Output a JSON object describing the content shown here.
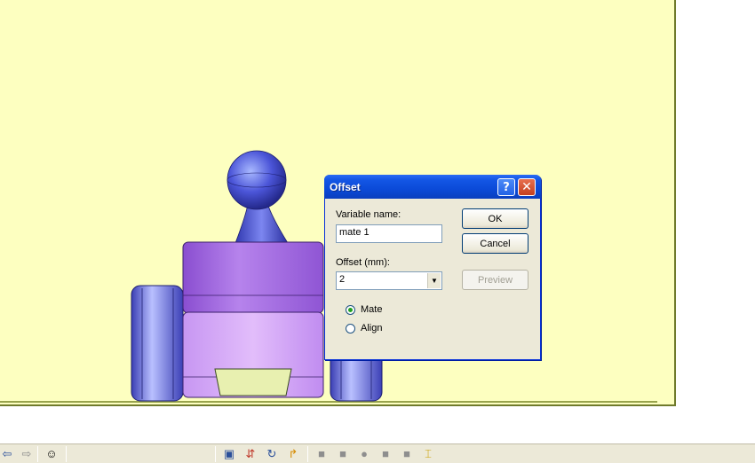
{
  "dialog": {
    "title": "Offset",
    "help_label": "?",
    "close_label": "✕",
    "variable_name_label": "Variable name:",
    "variable_name_value": "mate 1",
    "offset_label": "Offset (mm):",
    "offset_value": "2",
    "ok_label": "OK",
    "cancel_label": "Cancel",
    "preview_label": "Preview",
    "radios": [
      {
        "label": "Mate",
        "checked": true
      },
      {
        "label": "Align",
        "checked": false
      }
    ]
  },
  "toolbar": {
    "icons": [
      "back-arrow-icon",
      "forward-arrow-icon",
      "smiley-icon",
      "mate-icon",
      "align-icon",
      "rotate-icon",
      "tangent-icon",
      "part-icon-1",
      "part-icon-2",
      "part-icon-3",
      "part-icon-4",
      "part-icon-5",
      "part-icon-6"
    ]
  },
  "colors": {
    "viewport_bg": "#fdffc0",
    "body_purple": "#b07ce8",
    "wheel_blue": "#5858c8",
    "titlebar_blue": "#0b4ad8"
  }
}
